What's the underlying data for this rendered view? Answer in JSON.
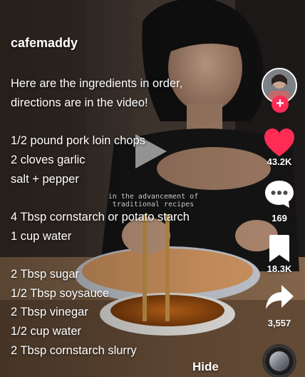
{
  "post": {
    "username": "cafemaddy",
    "caption_lines": [
      "Here are the ingredients in order,",
      "directions are in the video!",
      "",
      "1/2 pound pork loin chops",
      "2 cloves garlic",
      "salt + pepper",
      "",
      "4 Tbsp cornstarch or potato starch",
      "1 cup water",
      "",
      "2 Tbsp sugar",
      "1/2 Tbsp soysauce",
      "2 Tbsp vinegar",
      "1/2 cup water",
      "2 Tbsp cornstarch slurry"
    ],
    "hide_label": "Hide"
  },
  "video": {
    "subtitle_line1": "in the advancement of",
    "subtitle_line2": "traditional recipes",
    "state": "paused"
  },
  "actions": {
    "likes": "43.2K",
    "comments": "169",
    "saves": "18.3K",
    "shares": "3,557",
    "follow_symbol": "+",
    "liked": true
  },
  "colors": {
    "like": "#fe2c55",
    "follow_badge": "#fe2c55",
    "text": "#ffffff"
  },
  "icons": {
    "like": "heart-icon",
    "comment": "comment-bubble-icon",
    "save": "bookmark-icon",
    "share": "share-arrow-icon",
    "play": "play-icon",
    "follow": "plus-icon",
    "music": "music-disc-icon"
  }
}
